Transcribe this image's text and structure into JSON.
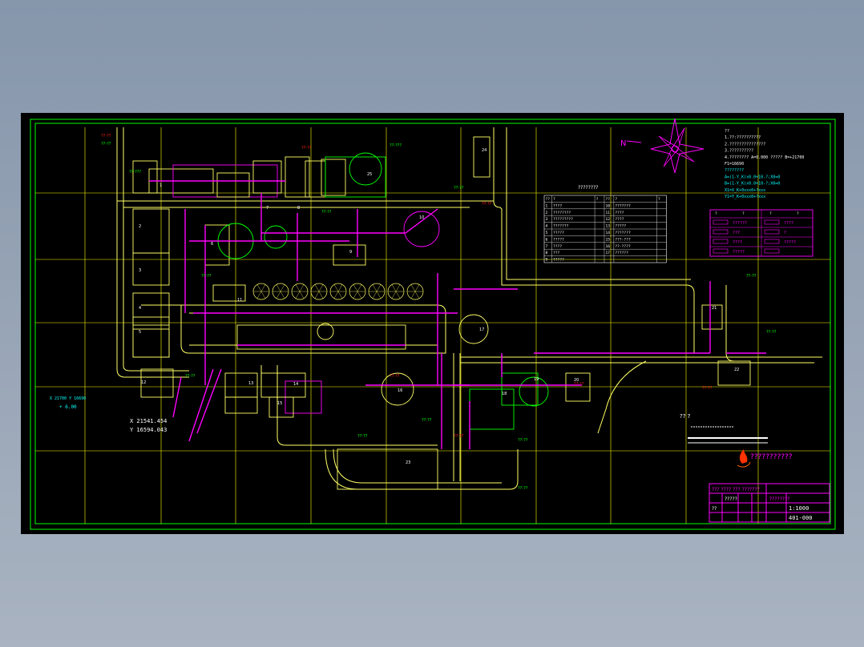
{
  "colors": {
    "background": "#000000",
    "frame": "#00ff00",
    "grid": "#ffff00",
    "roads": "#ffff66",
    "pipes": "#ff00ff",
    "labels": "#00ffff",
    "red": "#ff2020",
    "white": "#ffffff"
  },
  "icons": {
    "north_arrow": "wind-rose-icon",
    "logo": "flame-logo-icon"
  },
  "north_label": "N",
  "coords": {
    "x": "X 21541.454",
    "y": "Y 16594.043"
  },
  "left_marks": {
    "line1": "X 21700 Y 16690",
    "line2": "+ 6.00"
  },
  "legend_table": {
    "title": "????????",
    "header": [
      "??",
      "?",
      "?",
      "??",
      "?",
      "?"
    ],
    "rows": [
      [
        "1",
        "????",
        "",
        "10",
        "???????",
        ""
      ],
      [
        "2",
        "????????",
        "",
        "11",
        "????",
        ""
      ],
      [
        "3",
        "?????????",
        "",
        "12",
        "????",
        ""
      ],
      [
        "4",
        "???????",
        "",
        "13",
        "?????",
        ""
      ],
      [
        "5",
        "?????",
        "",
        "14",
        "???????",
        ""
      ],
      [
        "6",
        "?????",
        "",
        "15",
        "???-???",
        ""
      ],
      [
        "7",
        "????",
        "",
        "16",
        "??-????",
        ""
      ],
      [
        "8",
        "???",
        "",
        "17",
        "??????",
        ""
      ],
      [
        "9",
        "?????",
        "",
        "",
        "",
        ""
      ]
    ]
  },
  "notes": [
    "??",
    "1.??:??????????",
    "2.???????????????",
    "3.??????????",
    "4.???????? A=0.000 ????? B=+21700",
    "F1=16690",
    "????????",
    "A=(1-Y_K)x0.0+10-?;X0=0",
    "B=(1-Y_K)x0.0+10-?;X0=0",
    "X1=X_K+0xxx0+?xxx",
    "Y1=Y_K+0xxx0+?xxx"
  ],
  "legend_right": {
    "title_row": [
      "?",
      "?",
      "?",
      "?"
    ],
    "rows": [
      [
        "??????",
        "????"
      ],
      [
        "???",
        "?"
      ],
      [
        "????",
        "?????"
      ],
      [
        "?????",
        ""
      ]
    ]
  },
  "center_note": "?? ?",
  "company_label": "???????????",
  "title_block": {
    "company": "??? ???? ??? ???????",
    "project": "????????",
    "drawing_name": "?????",
    "scale": "1:1000",
    "drawing_no": "401-000",
    "stamp": "??"
  },
  "area_labels": [
    "1",
    "2",
    "3",
    "4",
    "5",
    "6",
    "7",
    "8",
    "9",
    "10",
    "11",
    "12",
    "13",
    "14",
    "15",
    "16",
    "17",
    "18",
    "19",
    "20",
    "21",
    "22",
    "23",
    "24",
    "25"
  ],
  "pipe_tags": [
    "??-??",
    "??-??",
    "??-???",
    "??-??",
    "??-???",
    "??-??",
    "??-??",
    "??-??",
    "??-??",
    "??-??",
    "??-??",
    "??-??",
    "??-??",
    "??-??",
    "??-??",
    "??-??",
    "??-??",
    "??-??",
    "??-??",
    "??-??"
  ]
}
